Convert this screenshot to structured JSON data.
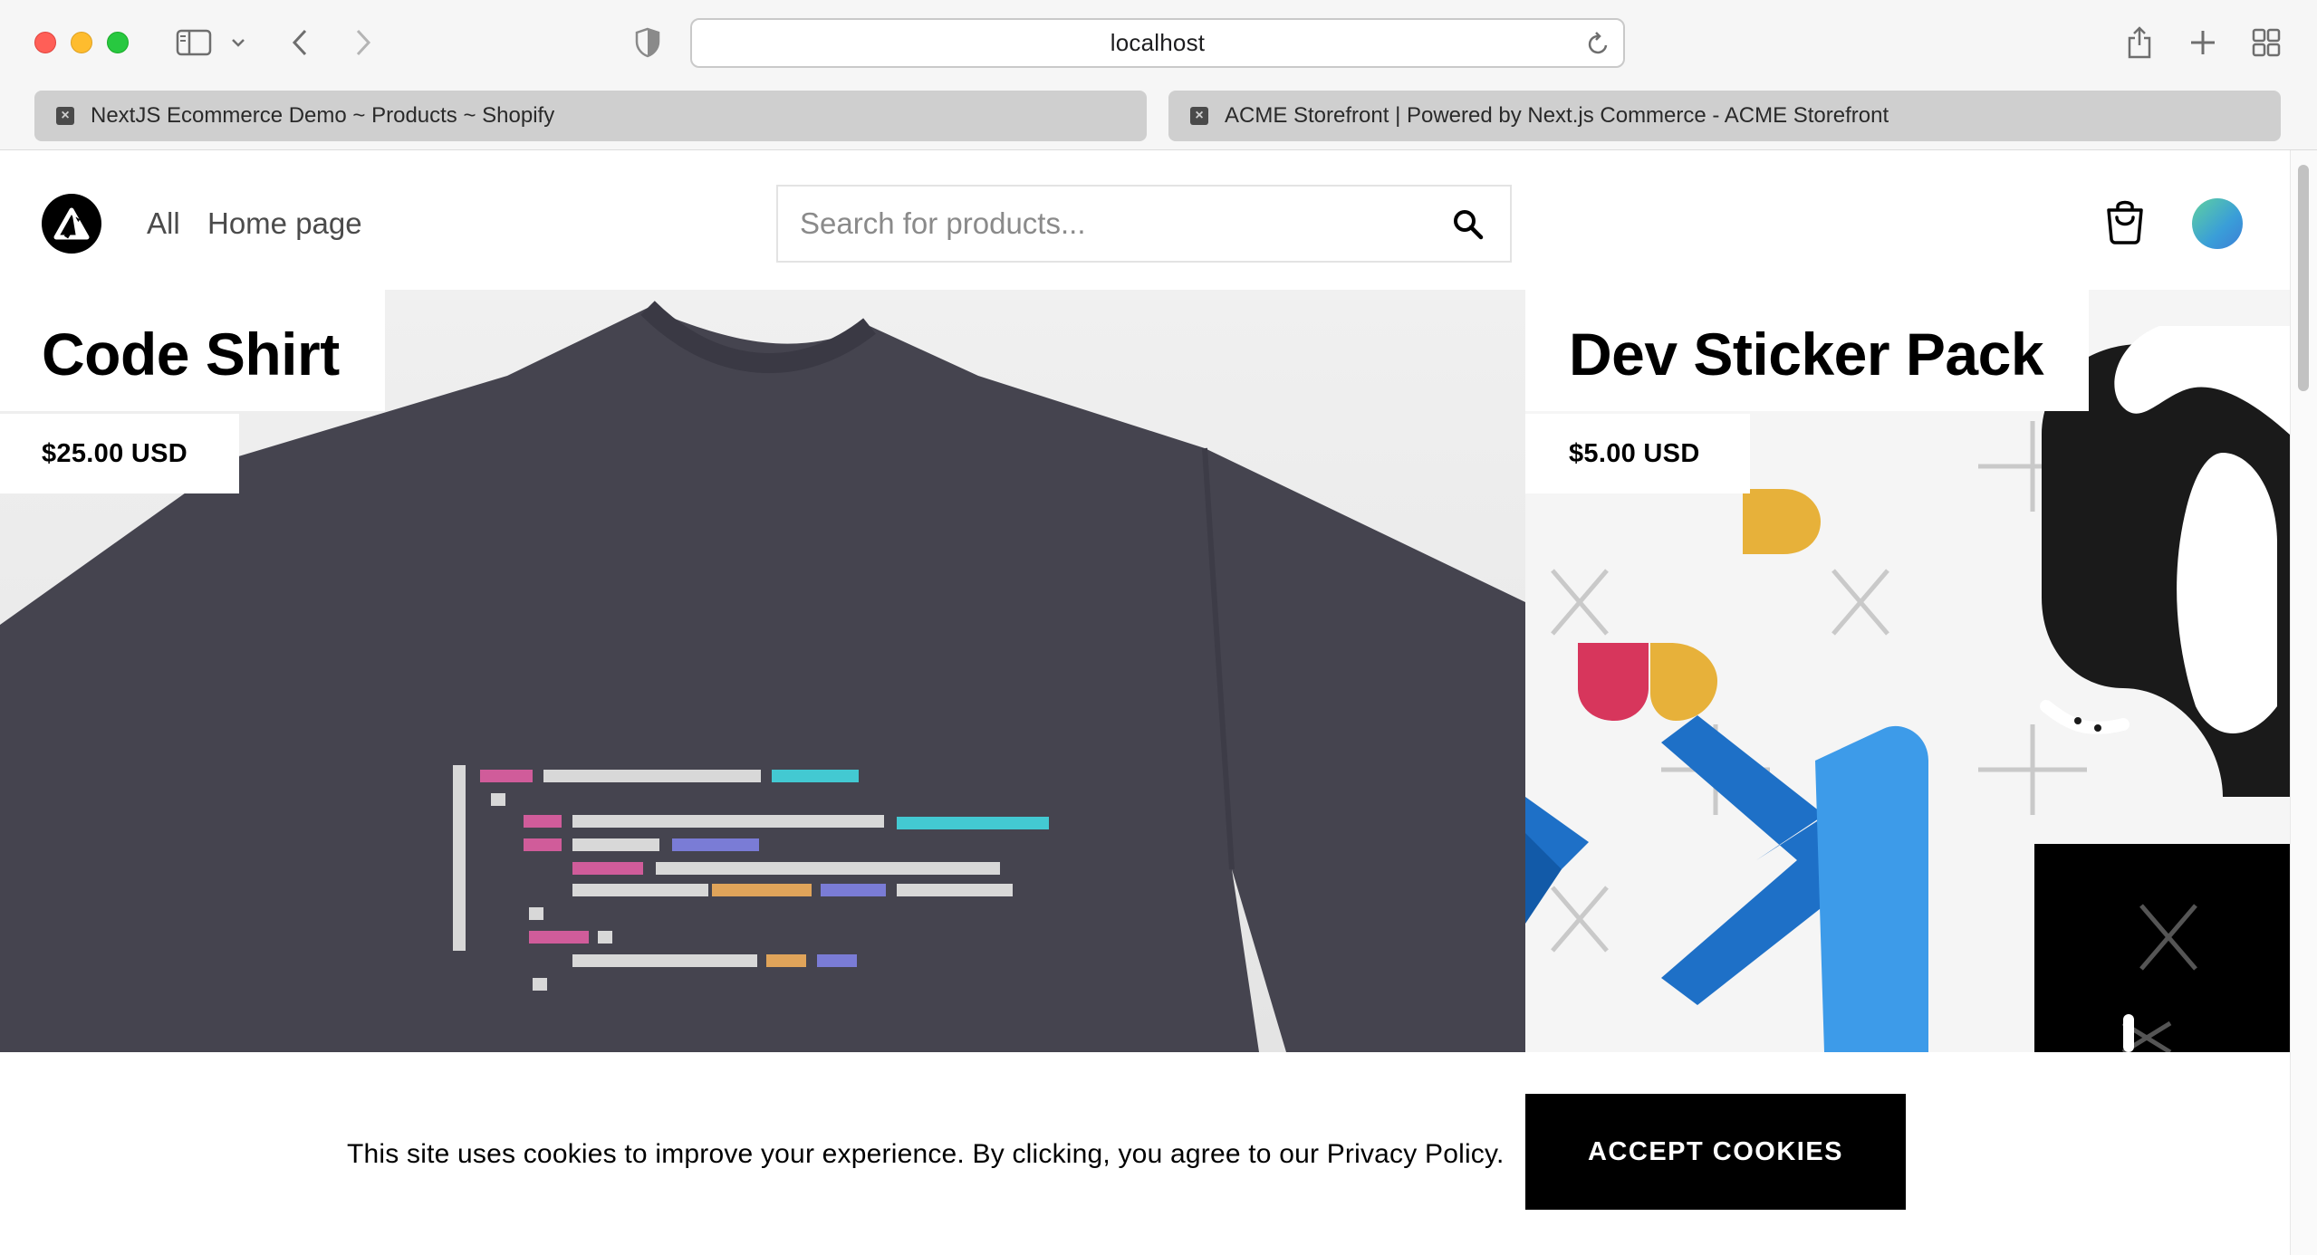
{
  "browser": {
    "url": "localhost",
    "tabs": [
      {
        "title": "NextJS Ecommerce Demo ~ Products ~ Shopify"
      },
      {
        "title": "ACME Storefront | Powered by Next.js Commerce - ACME Storefront"
      }
    ],
    "toolbar_icons": [
      "sidebar-icon",
      "chevron-down-icon",
      "back-icon",
      "forward-icon",
      "privacy-shield-icon",
      "reload-icon",
      "share-icon",
      "new-tab-icon",
      "tab-overview-icon"
    ]
  },
  "nav": {
    "links": [
      {
        "label": "All"
      },
      {
        "label": "Home page"
      }
    ],
    "search_placeholder": "Search for products...",
    "icons": [
      "logo-icon",
      "search-icon",
      "cart-icon",
      "avatar"
    ]
  },
  "products": [
    {
      "title": "Code Shirt",
      "price": "$25.00 USD"
    },
    {
      "title": "Dev Sticker Pack",
      "price": "$5.00 USD"
    }
  ],
  "cookie_banner": {
    "message": "This site uses cookies to improve your experience. By clicking, you agree to our Privacy Policy.",
    "button_label": "ACCEPT COOKIES"
  },
  "colors": {
    "shirt": "#45444f",
    "traffic_red": "#ff5f57",
    "traffic_yellow": "#febc2e",
    "traffic_green": "#28c840"
  }
}
